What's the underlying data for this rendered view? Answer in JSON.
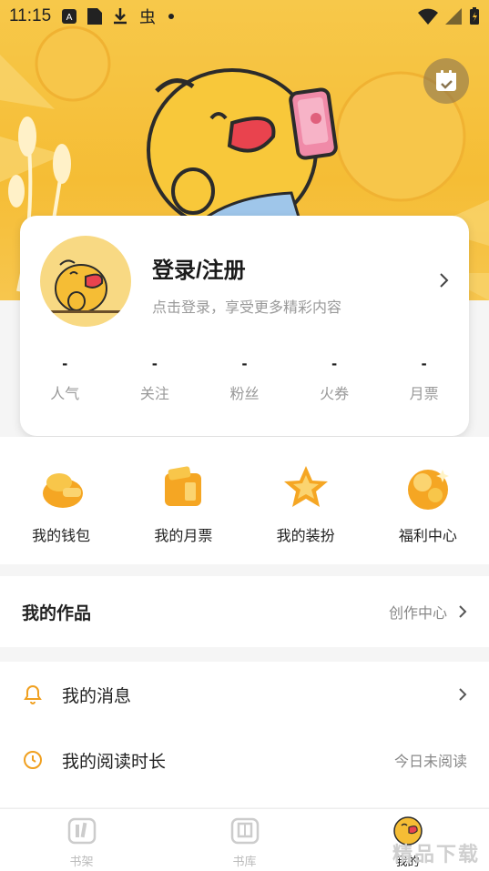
{
  "status_bar": {
    "time": "11:15"
  },
  "profile": {
    "title": "登录/注册",
    "subtitle": "点击登录，享受更多精彩内容",
    "stats": [
      {
        "value": "-",
        "label": "人气"
      },
      {
        "value": "-",
        "label": "关注"
      },
      {
        "value": "-",
        "label": "粉丝"
      },
      {
        "value": "-",
        "label": "火券"
      },
      {
        "value": "-",
        "label": "月票"
      }
    ]
  },
  "features": [
    {
      "label": "我的钱包",
      "icon": "wallet-icon"
    },
    {
      "label": "我的月票",
      "icon": "monthly-ticket-icon"
    },
    {
      "label": "我的装扮",
      "icon": "dress-up-star-icon"
    },
    {
      "label": "福利中心",
      "icon": "welfare-center-icon"
    }
  ],
  "works": {
    "title": "我的作品",
    "link": "创作中心"
  },
  "list": [
    {
      "label": "我的消息",
      "icon": "bell-icon",
      "right": ""
    },
    {
      "label": "我的阅读时长",
      "icon": "clock-icon",
      "right": "今日未阅读"
    }
  ],
  "tabs": [
    {
      "label": "书架",
      "icon": "bookshelf-icon"
    },
    {
      "label": "书库",
      "icon": "library-icon"
    },
    {
      "label": "我的",
      "icon": "profile-avatar-icon"
    }
  ],
  "watermark": "精品下载",
  "colors": {
    "hero": "#f5bd35",
    "accent": "#f0a020",
    "text": "#222222",
    "muted": "#999999"
  }
}
